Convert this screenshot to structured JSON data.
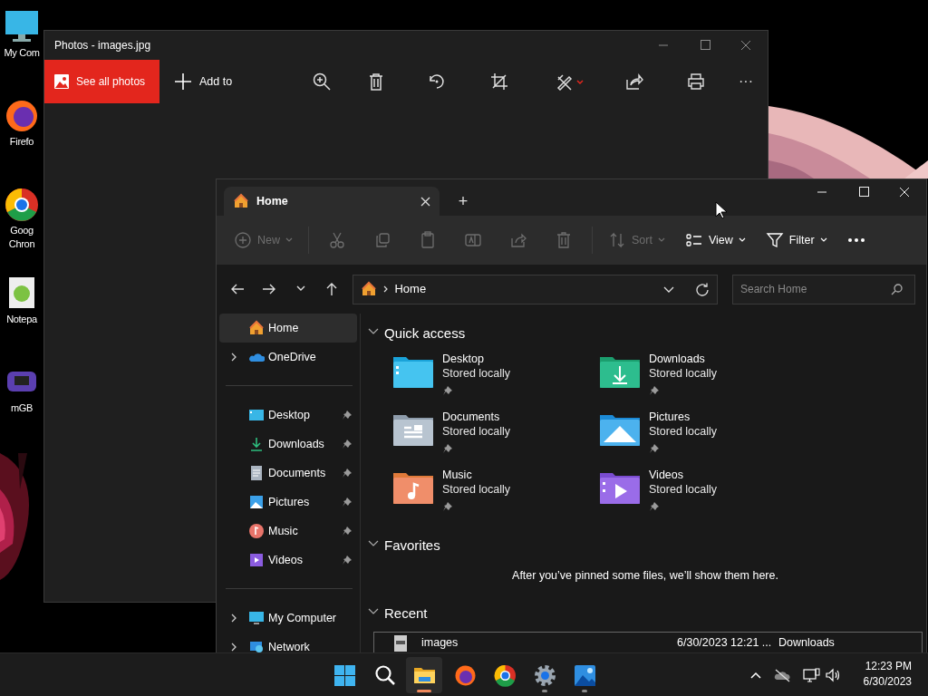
{
  "desktop_icons": [
    {
      "label": "My Com"
    },
    {
      "label": "Firefo"
    },
    {
      "label": "Goog\nChron"
    },
    {
      "label": "Notepa"
    },
    {
      "label": "mGB"
    }
  ],
  "photos_window": {
    "title": "Photos - images.jpg",
    "see_all": "See all photos",
    "add_to": "Add to",
    "more": "···"
  },
  "explorer": {
    "tab": {
      "label": "Home",
      "selected": true
    },
    "new_tab": "+",
    "toolbar": {
      "new": {
        "label": "New",
        "disabled": true
      },
      "edit_buttons": [
        {
          "disabled": true
        },
        {
          "disabled": true
        },
        {
          "disabled": true
        },
        {
          "disabled": true
        },
        {
          "disabled": true
        },
        {
          "disabled": true
        }
      ],
      "sort": {
        "label": "Sort",
        "disabled": true
      },
      "view": {
        "label": "View",
        "disabled": false
      },
      "filter": {
        "label": "Filter",
        "disabled": false
      }
    },
    "address": {
      "path": "Home"
    },
    "search": {
      "placeholder": "Search Home"
    },
    "sidebar_groups": [
      {
        "items": [
          {
            "label": "Home",
            "selected": true,
            "expandable": false,
            "pinned": false
          },
          {
            "label": "OneDrive",
            "selected": false,
            "expandable": true,
            "pinned": false
          }
        ]
      },
      {
        "items": [
          {
            "label": "Desktop",
            "selected": false,
            "expandable": false,
            "pinned": true
          },
          {
            "label": "Downloads",
            "selected": false,
            "expandable": false,
            "pinned": true
          },
          {
            "label": "Documents",
            "selected": false,
            "expandable": false,
            "pinned": true
          },
          {
            "label": "Pictures",
            "selected": false,
            "expandable": false,
            "pinned": true
          },
          {
            "label": "Music",
            "selected": false,
            "expandable": false,
            "pinned": true
          },
          {
            "label": "Videos",
            "selected": false,
            "expandable": false,
            "pinned": true
          }
        ]
      },
      {
        "items": [
          {
            "label": "My Computer",
            "selected": false,
            "expandable": true,
            "pinned": false
          },
          {
            "label": "Network",
            "selected": false,
            "expandable": true,
            "pinned": false
          }
        ]
      }
    ],
    "quick_access": {
      "title": "Quick access",
      "expanded": true,
      "items": [
        {
          "name": "Desktop",
          "status": "Stored locally",
          "pinned": true
        },
        {
          "name": "Downloads",
          "status": "Stored locally",
          "pinned": true
        },
        {
          "name": "Documents",
          "status": "Stored locally",
          "pinned": true
        },
        {
          "name": "Pictures",
          "status": "Stored locally",
          "pinned": true
        },
        {
          "name": "Music",
          "status": "Stored locally",
          "pinned": true
        },
        {
          "name": "Videos",
          "status": "Stored locally",
          "pinned": true
        }
      ]
    },
    "favorites": {
      "title": "Favorites",
      "expanded": true,
      "empty_text": "After you’ve pinned some files, we’ll show them here."
    },
    "recent": {
      "title": "Recent",
      "expanded": true,
      "files": [
        {
          "name": "images",
          "date": "6/30/2023 12:21 ...",
          "location": "Downloads"
        }
      ]
    }
  },
  "taskbar": {
    "apps": [
      {
        "running": false,
        "active": false
      },
      {
        "running": false,
        "active": false
      },
      {
        "running": true,
        "active": true
      },
      {
        "running": false,
        "active": false
      },
      {
        "running": false,
        "active": false
      },
      {
        "running": true,
        "active": false
      },
      {
        "running": true,
        "active": false
      }
    ],
    "time": "12:23 PM",
    "date": "6/30/2023"
  }
}
